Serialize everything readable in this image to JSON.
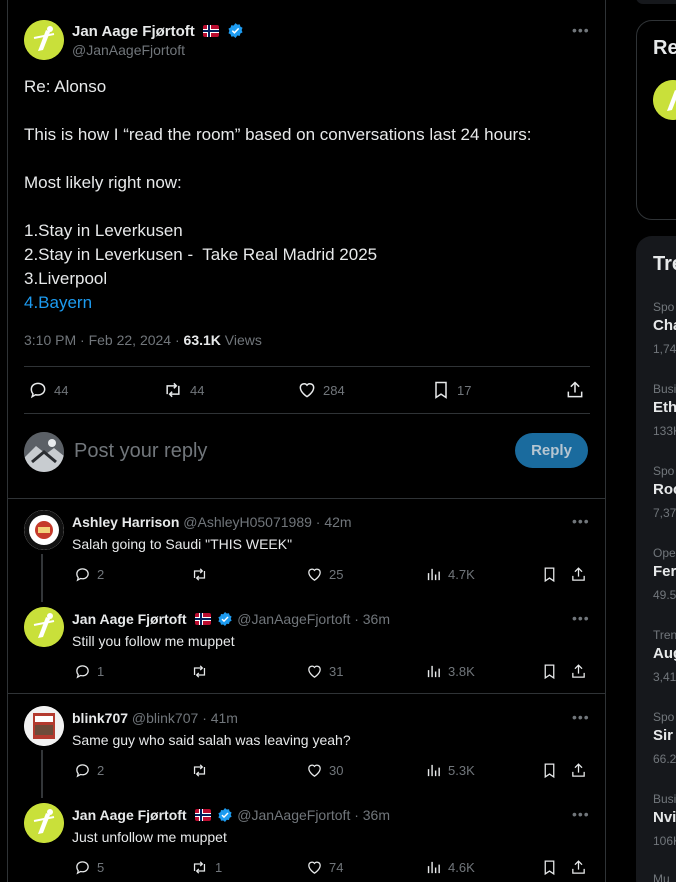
{
  "main_tweet": {
    "author_name": "Jan Aage Fjørtoft",
    "handle": "@JanAageFjortoft",
    "lines": [
      "Re: Alonso",
      "",
      "This is how I “read the room” based on conversations last 24 hours:",
      "",
      "Most likely right now:",
      "",
      "1.Stay in Leverkusen",
      "2.Stay in Leverkusen -  Take Real Madrid 2025",
      "3.Liverpool"
    ],
    "link_line": "4.Bayern",
    "timestamp": "3:10 PM · Feb 22, 2024 · ",
    "views_count": "63.1K",
    "views_label": " Views",
    "stats": {
      "replies": "44",
      "retweets": "44",
      "likes": "284",
      "bookmarks": "17"
    }
  },
  "reply_box": {
    "placeholder": "Post your reply",
    "button": "Reply"
  },
  "replies": [
    {
      "name": "Ashley Harrison",
      "handle": "@AshleyH05071989",
      "time": "· 42m",
      "text": "Salah going to Saudi \"THIS WEEK\"",
      "replies": "2",
      "retweets": "",
      "likes": "25",
      "views": "4.7K"
    },
    {
      "name": "Jan Aage Fjørtoft",
      "handle": "@JanAageFjortoft",
      "time": "· 36m",
      "text": "Still you follow me muppet",
      "replies": "1",
      "retweets": "",
      "likes": "31",
      "views": "3.8K"
    },
    {
      "name": "blink707",
      "handle": "@blink707",
      "time": "· 41m",
      "text": "Same guy who said salah was leaving yeah?",
      "replies": "2",
      "retweets": "",
      "likes": "30",
      "views": "5.3K"
    },
    {
      "name": "Jan Aage Fjørtoft",
      "handle": "@JanAageFjortoft",
      "time": "· 36m",
      "text": "Just unfollow me muppet",
      "replies": "5",
      "retweets": "1",
      "likes": "74",
      "views": "4.6K"
    }
  ],
  "sidebar": {
    "box_title": "Re",
    "trends_title": "Tre",
    "trends": [
      {
        "category": "Spo",
        "name": "Cha",
        "count": "1,74"
      },
      {
        "category": "Busi",
        "name": "Eth",
        "count": "133K"
      },
      {
        "category": "Spo",
        "name": "Roc",
        "count": "7,37"
      },
      {
        "category": "Ope",
        "name": "Fer",
        "count": "49.5"
      },
      {
        "category": "Tren",
        "name": "Aug",
        "count": "3,41"
      },
      {
        "category": "Spo",
        "name": "Sir ",
        "count": "66.2"
      },
      {
        "category": "Busi",
        "name": "Nvi",
        "count": "106K"
      },
      {
        "category": "Mu",
        "name": "",
        "count": ""
      }
    ]
  },
  "colors": {
    "accent": "#1d9bf0",
    "verified": "#1d9bf0",
    "background": "#000000",
    "border": "#2f3336"
  }
}
